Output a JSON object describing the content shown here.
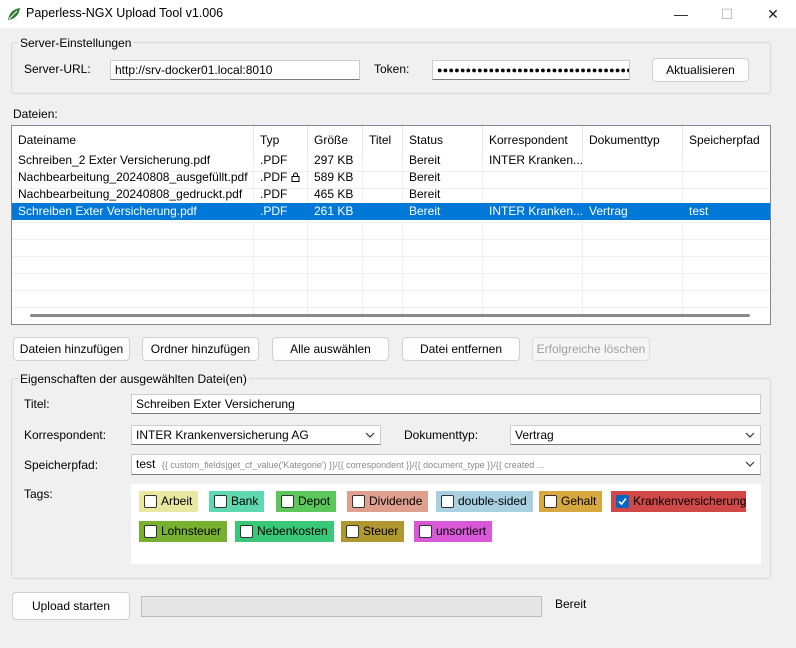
{
  "window": {
    "title": "Paperless-NGX Upload Tool v1.006",
    "minimize_glyph": "—",
    "maximize_glyph": "☐",
    "close_glyph": "✕",
    "icon": "leaf-icon",
    "icon_color": "#2e7d32"
  },
  "server": {
    "group_title": "Server-Einstellungen",
    "url_label": "Server-URL:",
    "url_value": "http://srv-docker01.local:8010",
    "token_label": "Token:",
    "token_value": "●●●●●●●●●●●●●●●●●●●●●●●●●●●●●●●●●●●●",
    "refresh_button": "Aktualisieren"
  },
  "files": {
    "section_label": "Dateien:",
    "columns": [
      "Dateiname",
      "Typ",
      "Größe",
      "Titel",
      "Status",
      "Korrespondent",
      "Dokumenttyp",
      "Speicherpfad"
    ],
    "rows": [
      {
        "name": "Schreiben_2 Exter Versicherung.pdf",
        "type": ".PDF",
        "size": "297 KB",
        "title": "",
        "status": "Bereit",
        "correspondent": "INTER Kranken...",
        "doctype": "",
        "path": ""
      },
      {
        "name": "Nachbearbeitung_20240808_ausgefüllt.pdf",
        "type": ".PDF",
        "size": "589 KB",
        "title": "",
        "status": "Bereit",
        "correspondent": "",
        "doctype": "",
        "path": ""
      },
      {
        "name": "Nachbearbeitung_20240808_gedruckt.pdf",
        "type": ".PDF",
        "size": "465 KB",
        "title": "",
        "status": "Bereit",
        "correspondent": "",
        "doctype": "",
        "path": ""
      },
      {
        "name": "Schreiben Exter Versicherung.pdf",
        "type": ".PDF",
        "size": "261 KB",
        "title": "",
        "status": "Bereit",
        "correspondent": "INTER Kranken...",
        "doctype": "Vertrag",
        "path": "test"
      }
    ],
    "locked_row_icon": "lock-icon",
    "selected_color": "#0078d7"
  },
  "actions": {
    "add_files": "Dateien hinzufügen",
    "add_folder": "Ordner hinzufügen",
    "select_all": "Alle auswählen",
    "remove_file": "Datei entfernen",
    "clear_successful": "Erfolgreiche löschen"
  },
  "properties": {
    "group_title": "Eigenschaften der ausgewählten Datei(en)",
    "title_label": "Titel:",
    "title_value": "Schreiben Exter Versicherung",
    "correspondent_label": "Korrespondent:",
    "correspondent_value": "INTER Krankenversicherung AG",
    "doctype_label": "Dokumenttyp:",
    "doctype_value": "Vertrag",
    "path_label": "Speicherpfad:",
    "path_name": "test",
    "path_template": "{{ custom_fields|get_cf_value('Kategorie') }}/{{ correspondent }}/{{ document_type }}/{{ created ...",
    "tags_label": "Tags:",
    "tags": [
      {
        "name": "Arbeit",
        "color": "#e8e8a0",
        "checked": false
      },
      {
        "name": "Bank",
        "color": "#5fd8b0",
        "checked": false
      },
      {
        "name": "Depot",
        "color": "#5cc85c",
        "checked": false
      },
      {
        "name": "Dividende",
        "color": "#e0a090",
        "checked": false
      },
      {
        "name": "double-sided",
        "color": "#a8d0e0",
        "checked": false
      },
      {
        "name": "Gehalt",
        "color": "#d8a840",
        "checked": false
      },
      {
        "name": "Krankenversicherung",
        "color": "#d04848",
        "checked": true
      },
      {
        "name": "Lohnsteuer",
        "color": "#78b030",
        "checked": false
      },
      {
        "name": "Nebenkosten",
        "color": "#38c878",
        "checked": false
      },
      {
        "name": "Steuer",
        "color": "#b09830",
        "checked": false
      },
      {
        "name": "unsortiert",
        "color": "#d858d8",
        "checked": false
      }
    ]
  },
  "upload": {
    "start_button": "Upload starten",
    "progress": 0,
    "status": "Bereit"
  }
}
